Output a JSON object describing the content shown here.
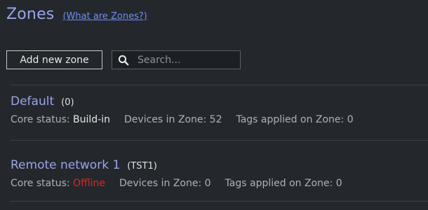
{
  "header": {
    "title": "Zones",
    "help_link": "(What are Zones?)"
  },
  "toolbar": {
    "add_label": "Add new zone",
    "search_placeholder": "Search...",
    "search_value": ""
  },
  "zones": [
    {
      "name": "Default",
      "code": "(0)",
      "core_status_label": "Core status:",
      "core_status_value": "Build-in",
      "core_status_color": "#e6e7e8",
      "devices_text": "Devices in Zone: 52",
      "tags_text": "Tags applied on Zone: 0"
    },
    {
      "name": "Remote network 1",
      "code": "(TST1)",
      "core_status_label": "Core status:",
      "core_status_value": "Offline",
      "core_status_color": "#d42828",
      "devices_text": "Devices in Zone: 0",
      "tags_text": "Tags applied on Zone: 0"
    }
  ],
  "colors": {
    "background": "#24282d",
    "accent": "#9aa5e8",
    "link": "#6f8ff0"
  },
  "icons": {
    "search": "search-icon"
  }
}
